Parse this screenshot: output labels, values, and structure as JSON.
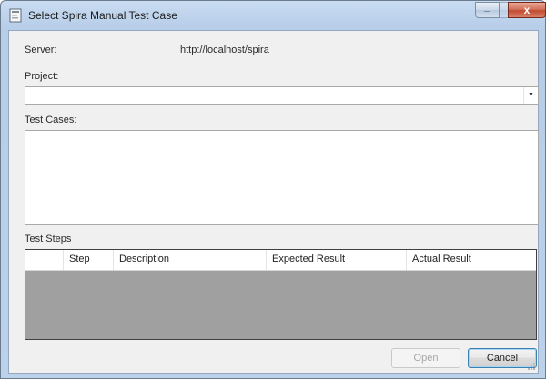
{
  "window": {
    "title": "Select Spira Manual Test Case",
    "controls": {
      "minimize": "_",
      "close": "x"
    }
  },
  "server": {
    "label": "Server:",
    "value": "http://localhost/spira"
  },
  "project": {
    "label": "Project:",
    "selected": ""
  },
  "test_cases": {
    "label": "Test Cases:",
    "items": []
  },
  "test_steps": {
    "label": "Test Steps",
    "columns": [
      "",
      "Step",
      "Description",
      "Expected Result",
      "Actual Result"
    ],
    "rows": []
  },
  "buttons": {
    "open": "Open",
    "cancel": "Cancel"
  }
}
